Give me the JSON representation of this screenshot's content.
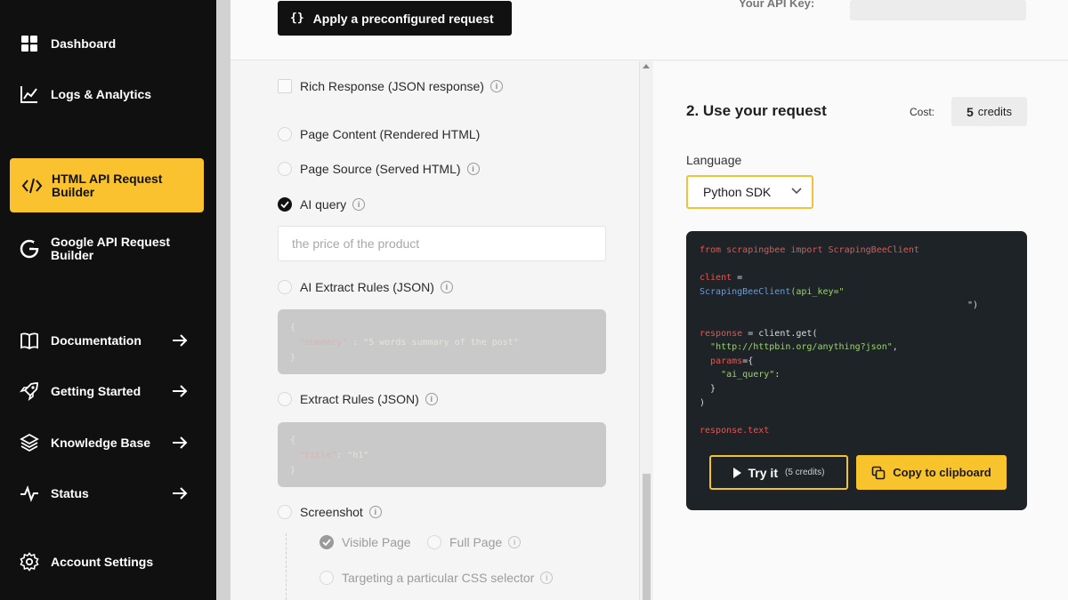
{
  "sidebar": {
    "dashboard": "Dashboard",
    "logs": "Logs & Analytics",
    "html_builder_1": "HTML API Request",
    "html_builder_2": "Builder",
    "google_builder_1": "Google API Request",
    "google_builder_2": "Builder",
    "documentation": "Documentation",
    "getting_started": "Getting Started",
    "knowledge_base": "Knowledge Base",
    "status": "Status",
    "account_settings": "Account Settings",
    "accent_color": "#f9c22e"
  },
  "header": {
    "apply_button": "Apply a preconfigured request",
    "apply_button_icon": "{}",
    "api_key_label": "Your API Key:"
  },
  "options": {
    "rich_response": "Rich Response (JSON response)",
    "page_content": "Page Content (Rendered HTML)",
    "page_source": "Page Source (Served HTML)",
    "ai_query": "AI query",
    "ai_query_placeholder": "the price of the product",
    "ai_extract_rules": "AI Extract Rules (JSON)",
    "ai_extract_code": {
      "open": "{",
      "key": "\"summary\"",
      "sep": " : ",
      "value": "\"5 words summary of the post\"",
      "close": "}"
    },
    "extract_rules": "Extract Rules (JSON)",
    "extract_code": {
      "open": "{",
      "key": "\"title\"",
      "sep": ": ",
      "value": "\"h1\"",
      "close": "}"
    },
    "screenshot": "Screenshot",
    "visible_page": "Visible Page",
    "full_page": "Full Page",
    "css_selector": "Targeting a particular CSS selector"
  },
  "request": {
    "title": "2. Use your request",
    "cost_label": "Cost:",
    "cost_value": "5",
    "cost_unit": "credits",
    "language_label": "Language",
    "language_value": "Python SDK",
    "code": {
      "l1_kw1": "from",
      "l1_mod": " scrapingbee ",
      "l1_kw2": "import",
      "l1_cls": " ScrapingBeeClient",
      "l3_var": "client",
      "l3_eq": " =",
      "l4_cls": "ScrapingBeeClient",
      "l4_arg": "(api_key=\"",
      "l5_close": "\")",
      "l7_var": "response",
      "l7_rest": " = client.get(",
      "l8_url": "\"http://httpbin.org/anything?json\"",
      "l8_comma": ",",
      "l9_params": "params",
      "l9_rest": "={",
      "l10_key": "\"ai_query\"",
      "l10_colon": ":",
      "l11": "}",
      "l12": ")",
      "l14": "response.text"
    },
    "try_button": "Try it",
    "try_credits": "(5 credits)",
    "copy_button": "Copy to clipboard"
  }
}
